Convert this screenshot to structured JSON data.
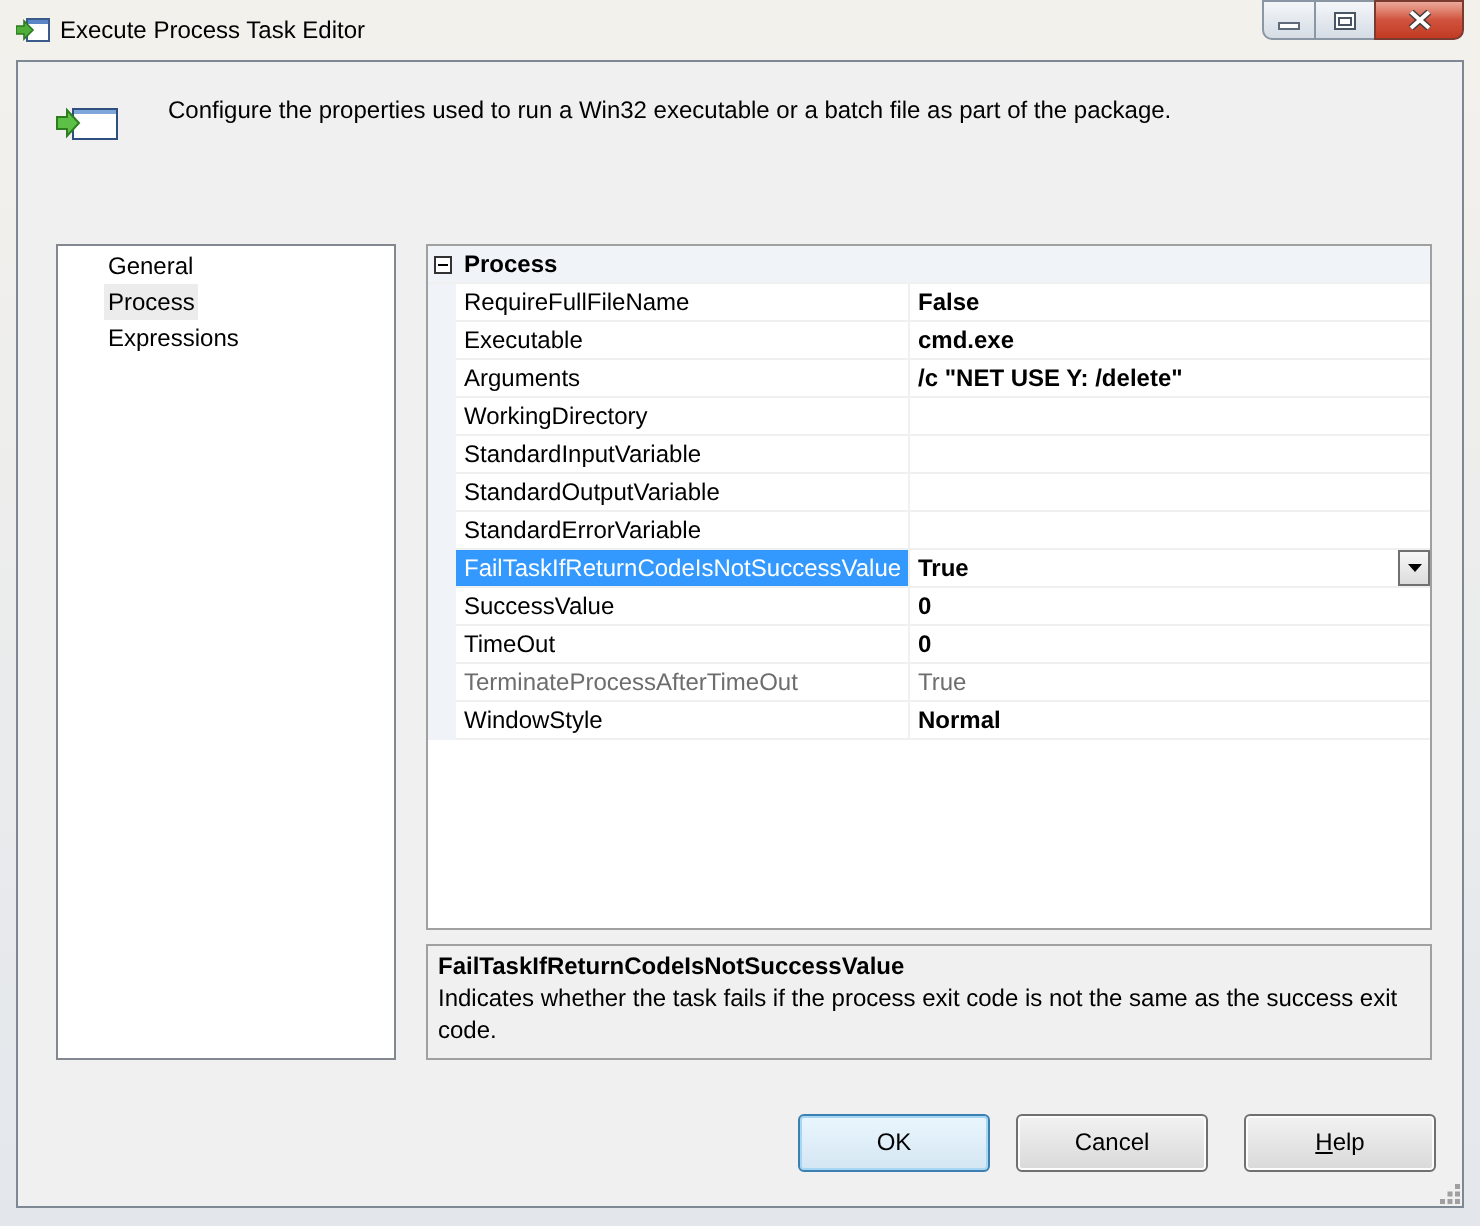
{
  "window": {
    "title": "Execute Process Task Editor"
  },
  "header": {
    "description": "Configure the properties used to run a Win32 executable or a batch file as part of the package."
  },
  "nav": {
    "items": [
      {
        "label": "General",
        "selected": false
      },
      {
        "label": "Process",
        "selected": true
      },
      {
        "label": "Expressions",
        "selected": false
      }
    ]
  },
  "property_grid": {
    "categories": [
      {
        "label": "Process",
        "expanded": true,
        "properties": [
          {
            "name": "RequireFullFileName",
            "value": "False",
            "modified": true,
            "disabled": false,
            "selected": false
          },
          {
            "name": "Executable",
            "value": "cmd.exe",
            "modified": true,
            "disabled": false,
            "selected": false
          },
          {
            "name": "Arguments",
            "value": "/c \"NET USE Y: /delete\"",
            "modified": true,
            "disabled": false,
            "selected": false
          },
          {
            "name": "WorkingDirectory",
            "disabled": false,
            "selected": false
          },
          {
            "name": "StandardInputVariable",
            "disabled": false,
            "selected": false
          },
          {
            "name": "StandardOutputVariable",
            "disabled": false,
            "selected": false
          },
          {
            "name": "StandardErrorVariable",
            "disabled": false,
            "selected": false
          },
          {
            "name": "FailTaskIfReturnCodeIsNotSuccessValue",
            "value": "True",
            "modified": true,
            "disabled": false,
            "selected": true,
            "dropdown_button": true
          },
          {
            "name": "SuccessValue",
            "value": "0",
            "modified": true,
            "disabled": false,
            "selected": false
          },
          {
            "name": "TimeOut",
            "value": "0",
            "modified": true,
            "disabled": false,
            "selected": false
          },
          {
            "name": "TerminateProcessAfterTimeOut",
            "value": "True",
            "modified": false,
            "disabled": true,
            "selected": false
          },
          {
            "name": "WindowStyle",
            "value": "Normal",
            "modified": true,
            "disabled": false,
            "selected": false
          }
        ]
      }
    ]
  },
  "description_panel": {
    "title": "FailTaskIfReturnCodeIsNotSuccessValue",
    "text": "Indicates whether the task fails if the process exit code is not the same as the success exit code."
  },
  "buttons": [
    {
      "label": "OK",
      "default": true,
      "access_key_shown": false
    },
    {
      "label": "Cancel",
      "default": false,
      "access_key_shown": false
    },
    {
      "label": "Help",
      "default": false,
      "access_key_shown": true
    }
  ]
}
